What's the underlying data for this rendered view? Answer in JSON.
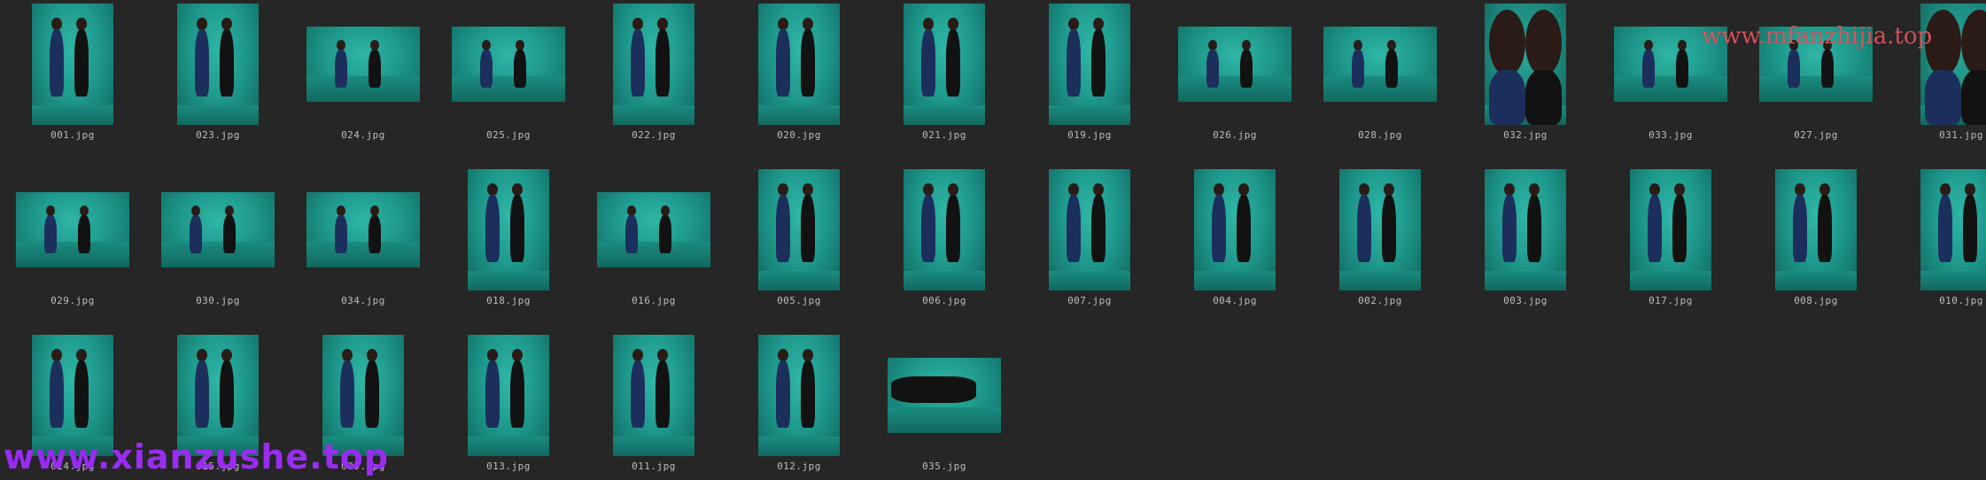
{
  "watermarks": {
    "top": "www.mfanzhijia.top",
    "bottom": "www.xianzushe.top"
  },
  "colors": {
    "background": "#262626",
    "caption": "#bdbdbd",
    "watermark_top": "#e2555f",
    "watermark_bottom": "#9a2cf2",
    "teal_backdrop": "#1f9a8d"
  },
  "rows": [
    {
      "items": [
        {
          "file": "001.jpg",
          "orientation": "portrait"
        },
        {
          "file": "023.jpg",
          "orientation": "portrait"
        },
        {
          "file": "024.jpg",
          "orientation": "landscape"
        },
        {
          "file": "025.jpg",
          "orientation": "landscape"
        },
        {
          "file": "022.jpg",
          "orientation": "portrait"
        },
        {
          "file": "020.jpg",
          "orientation": "portrait"
        },
        {
          "file": "021.jpg",
          "orientation": "portrait"
        },
        {
          "file": "019.jpg",
          "orientation": "portrait"
        },
        {
          "file": "026.jpg",
          "orientation": "landscape"
        },
        {
          "file": "028.jpg",
          "orientation": "landscape"
        },
        {
          "file": "032.jpg",
          "orientation": "portrait",
          "closeup": true
        },
        {
          "file": "033.jpg",
          "orientation": "landscape"
        },
        {
          "file": "027.jpg",
          "orientation": "landscape"
        },
        {
          "file": "031.jpg",
          "orientation": "portrait",
          "closeup": true
        }
      ]
    },
    {
      "items": [
        {
          "file": "029.jpg",
          "orientation": "landscape"
        },
        {
          "file": "030.jpg",
          "orientation": "landscape"
        },
        {
          "file": "034.jpg",
          "orientation": "landscape"
        },
        {
          "file": "018.jpg",
          "orientation": "portrait"
        },
        {
          "file": "016.jpg",
          "orientation": "landscape"
        },
        {
          "file": "005.jpg",
          "orientation": "portrait"
        },
        {
          "file": "006.jpg",
          "orientation": "portrait"
        },
        {
          "file": "007.jpg",
          "orientation": "portrait"
        },
        {
          "file": "004.jpg",
          "orientation": "portrait"
        },
        {
          "file": "002.jpg",
          "orientation": "portrait"
        },
        {
          "file": "003.jpg",
          "orientation": "portrait"
        },
        {
          "file": "017.jpg",
          "orientation": "portrait"
        },
        {
          "file": "008.jpg",
          "orientation": "portrait"
        },
        {
          "file": "010.jpg",
          "orientation": "portrait"
        }
      ]
    },
    {
      "items": [
        {
          "file": "014.jpg",
          "orientation": "portrait"
        },
        {
          "file": "015.jpg",
          "orientation": "portrait"
        },
        {
          "file": "009.jpg",
          "orientation": "portrait"
        },
        {
          "file": "013.jpg",
          "orientation": "portrait"
        },
        {
          "file": "011.jpg",
          "orientation": "portrait"
        },
        {
          "file": "012.jpg",
          "orientation": "portrait"
        },
        {
          "file": "035.jpg",
          "orientation": "landscape",
          "dark": true
        }
      ]
    }
  ]
}
